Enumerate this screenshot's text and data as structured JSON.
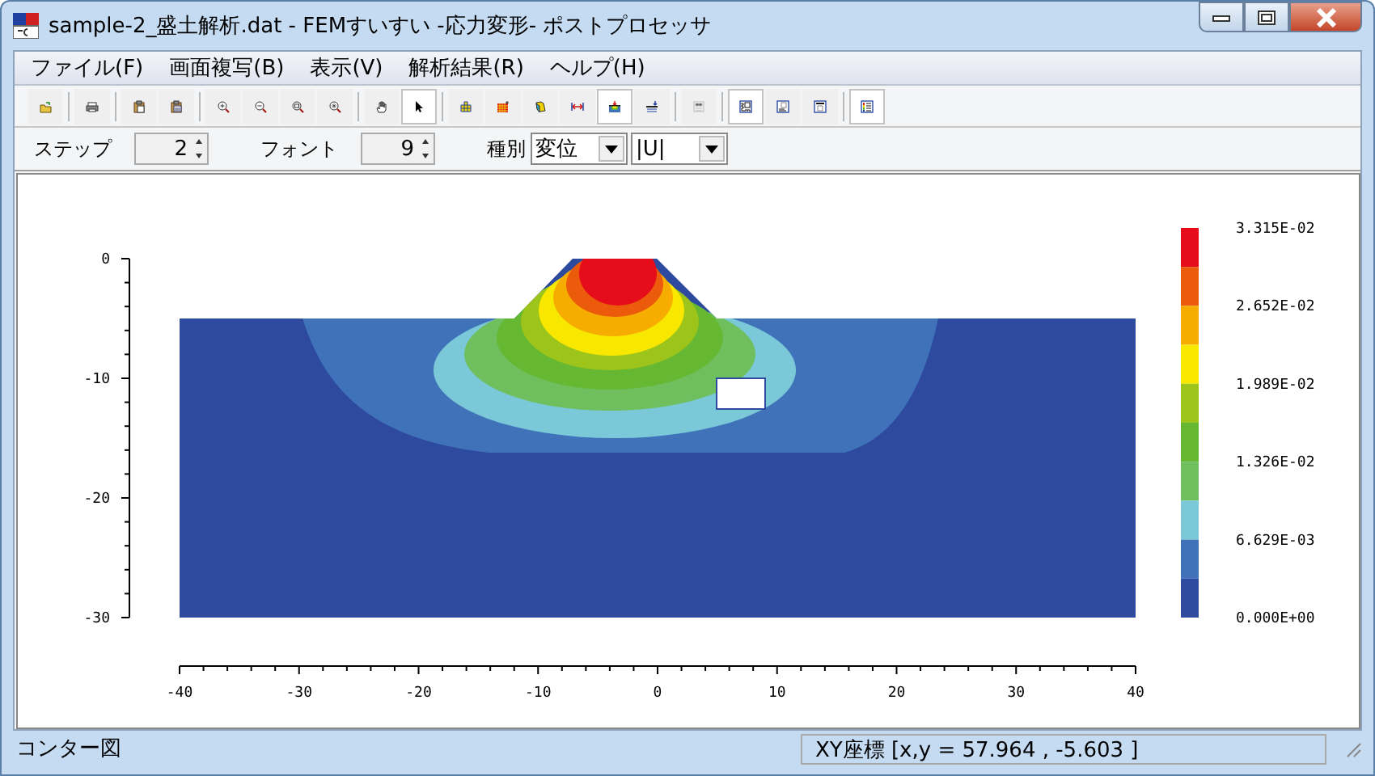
{
  "window": {
    "title": "sample-2_盛土解析.dat - FEMすいすい -応力変形- ポストプロセッサ"
  },
  "menu": [
    {
      "label": "ファイル(F)"
    },
    {
      "label": "画面複写(B)"
    },
    {
      "label": "表示(V)"
    },
    {
      "label": "解析結果(R)"
    },
    {
      "label": "ヘルプ(H)"
    }
  ],
  "toolbar": [
    {
      "pressed": false,
      "disabled": false
    },
    {
      "pressed": false,
      "disabled": false
    },
    {
      "pressed": false,
      "disabled": false
    },
    {
      "pressed": false,
      "disabled": false
    },
    {
      "pressed": false,
      "disabled": false
    },
    {
      "pressed": false,
      "disabled": false
    },
    {
      "pressed": false,
      "disabled": false
    },
    {
      "pressed": false,
      "disabled": false
    },
    {
      "pressed": false,
      "disabled": false
    },
    {
      "pressed": true,
      "disabled": false
    },
    {
      "pressed": false,
      "disabled": false
    },
    {
      "pressed": false,
      "disabled": false
    },
    {
      "pressed": false,
      "disabled": false
    },
    {
      "pressed": false,
      "disabled": false
    },
    {
      "pressed": true,
      "disabled": false
    },
    {
      "pressed": false,
      "disabled": false
    },
    {
      "pressed": false,
      "disabled": true
    },
    {
      "pressed": true,
      "disabled": false
    },
    {
      "pressed": false,
      "disabled": false
    },
    {
      "pressed": false,
      "disabled": false
    },
    {
      "pressed": true,
      "disabled": false
    }
  ],
  "controls": {
    "step_label": "ステップ",
    "step_value": "2",
    "font_label": "フォント",
    "font_value": "9",
    "type_label": "種別",
    "type_value": "変位",
    "component_value": "|U|"
  },
  "plot": {
    "x_ticks": [
      "-40",
      "-30",
      "-20",
      "-10",
      "0",
      "10",
      "20",
      "30",
      "40"
    ],
    "y_ticks": [
      "0",
      "-10",
      "-20",
      "-30"
    ],
    "legend_colors": [
      {
        "color": "#e60c1a"
      },
      {
        "color": "#ec5a0c"
      },
      {
        "color": "#f7ad00"
      },
      {
        "color": "#f8e800"
      },
      {
        "color": "#9dc41a"
      },
      {
        "color": "#66b832"
      },
      {
        "color": "#6fbf5f"
      },
      {
        "color": "#7ac8d8"
      },
      {
        "color": "#3f72b8"
      },
      {
        "color": "#2e4a9e"
      }
    ],
    "legend_labels": [
      "3.315E-02",
      "2.652E-02",
      "1.989E-02",
      "1.326E-02",
      "6.629E-03",
      "0.000E+00"
    ]
  },
  "status_bar": {
    "mode": "コンター図",
    "coords": "XY座標 [x,y  =  57.964 , -5.603 ]"
  }
}
